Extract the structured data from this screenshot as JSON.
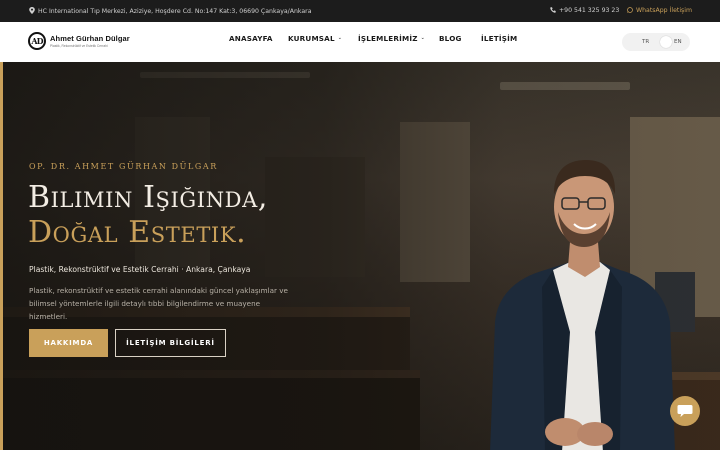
{
  "topbar": {
    "address_icon": "map-pin-icon",
    "address": "HC International Tıp Merkezi, Aziziye, Hoşdere Cd. No:147 Kat:3, 06690 Çankaya/Ankara",
    "phone_icon": "phone-icon",
    "phone": "+90 541 325 93 23",
    "whatsapp_icon": "whatsapp-icon",
    "whatsapp": "WhatsApp İletişim",
    "accent_color": "#c9a05a"
  },
  "logo": {
    "mark": "AD",
    "name": "Ahmet Gürhan Dülgar",
    "tagline": "Plastik, Rekonstrüktif ve Estetik Cerrahi"
  },
  "nav": {
    "items": [
      {
        "label": "ANASAYFA",
        "has_dropdown": false
      },
      {
        "label": "KURUMSAL",
        "has_dropdown": true
      },
      {
        "label": "İŞLEMLERİMİZ",
        "has_dropdown": true
      },
      {
        "label": "BLOG",
        "has_dropdown": false
      },
      {
        "label": "İLETİŞİM",
        "has_dropdown": false
      }
    ]
  },
  "language": {
    "options": [
      "TR",
      "EN"
    ],
    "selected": "EN"
  },
  "hero": {
    "eyebrow": "OP. DR. AHMET GÜRHAN DÜLGAR",
    "headline_line1": "Bilimin Işığında,",
    "headline_line2": "Doğal Estetik.",
    "subtitle": "Plastik, Rekonstrüktif ve Estetik Cerrahi · Ankara, Çankaya",
    "description_line1": "Plastik, rekonstrüktif ve estetik cerrahi alanındaki güncel yaklaşımlar ve",
    "description_line2": "bilimsel yöntemlerle ilgili detaylı tıbbi bilgilendirme ve muayene hizmetleri.",
    "primary_button": "HAKKIMDA",
    "secondary_button": "İLETİŞİM BİLGİLERİ"
  },
  "chat": {
    "icon": "chat-bubble-icon"
  }
}
